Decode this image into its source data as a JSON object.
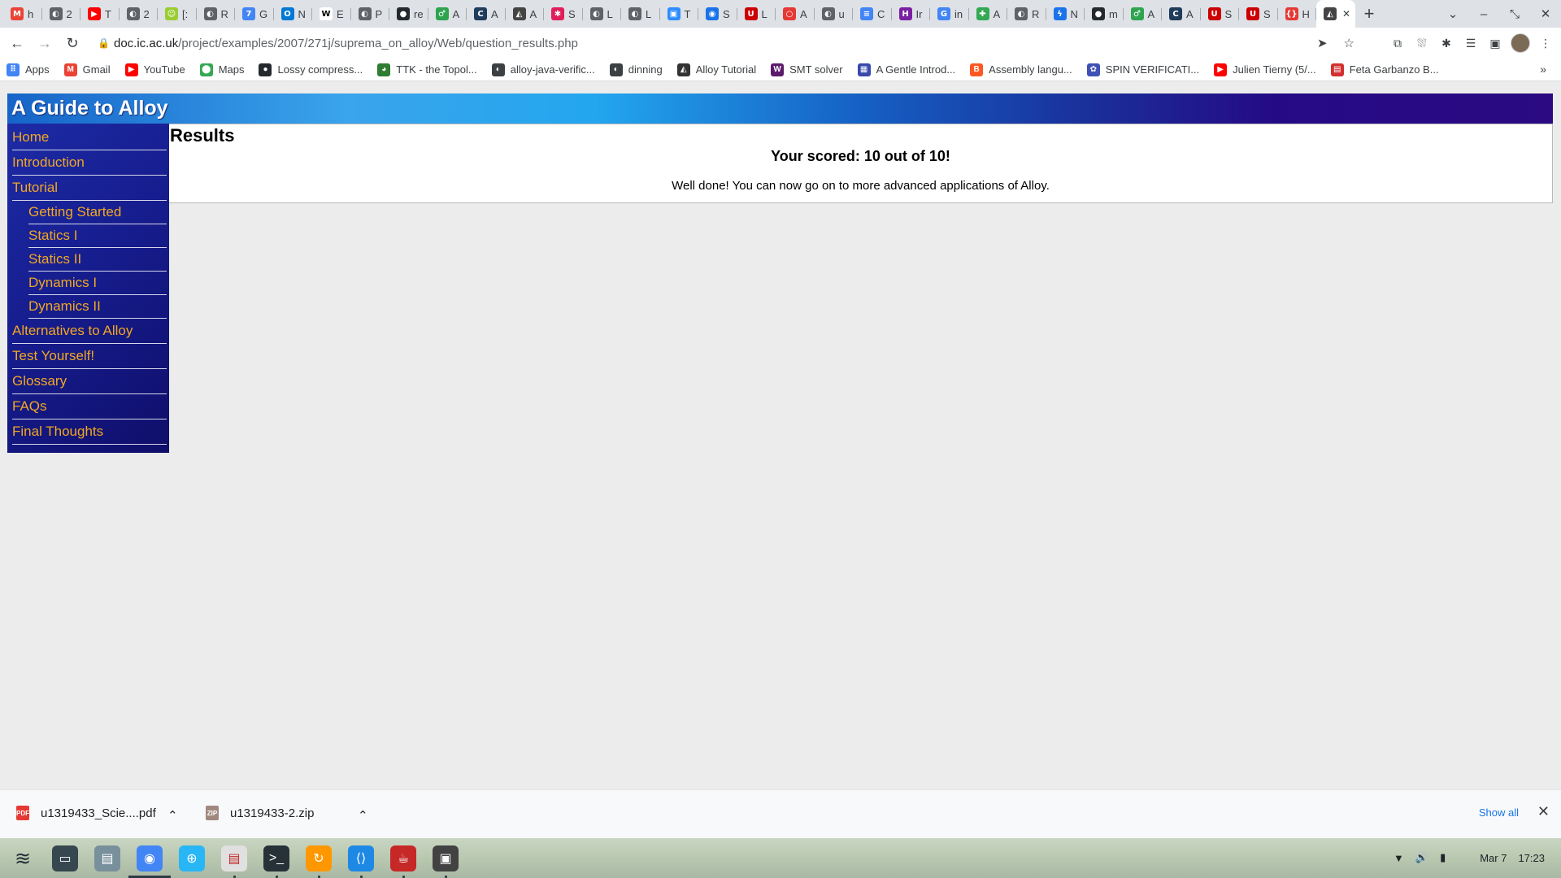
{
  "browser": {
    "tabs": [
      {
        "icon": "gmail-icon",
        "glyph": "M",
        "color": "#ea4335",
        "text": "h"
      },
      {
        "icon": "globe-icon",
        "glyph": "◐",
        "color": "#5f6368",
        "text": "2"
      },
      {
        "icon": "youtube-icon",
        "glyph": "▶",
        "color": "#ff0000",
        "text": "T"
      },
      {
        "icon": "globe-icon",
        "glyph": "◐",
        "color": "#5f6368",
        "text": "2"
      },
      {
        "icon": "smiley-icon",
        "glyph": "☺",
        "color": "#9acd32",
        "text": "[:"
      },
      {
        "icon": "globe-icon",
        "glyph": "◐",
        "color": "#5f6368",
        "text": "R"
      },
      {
        "icon": "calendar-icon",
        "glyph": "7",
        "color": "#4285f4",
        "text": "G"
      },
      {
        "icon": "outlook-icon",
        "glyph": "O",
        "color": "#0078d4",
        "text": "N"
      },
      {
        "icon": "wikipedia-icon",
        "glyph": "W",
        "color": "#ffffff",
        "text": "E"
      },
      {
        "icon": "globe-icon",
        "glyph": "◐",
        "color": "#5f6368",
        "text": "P"
      },
      {
        "icon": "github-icon",
        "glyph": "●",
        "color": "#24292e",
        "text": "re"
      },
      {
        "icon": "leaf-icon",
        "glyph": "♂",
        "color": "#2ea44f",
        "text": "A"
      },
      {
        "icon": "codecademy-icon",
        "glyph": "C",
        "color": "#1f3c5a",
        "text": "A"
      },
      {
        "icon": "alloy-icon",
        "glyph": "◭",
        "color": "#444444",
        "text": "A"
      },
      {
        "icon": "slack-icon",
        "glyph": "✱",
        "color": "#e01e5a",
        "text": "S"
      },
      {
        "icon": "globe-icon",
        "glyph": "◐",
        "color": "#5f6368",
        "text": "L"
      },
      {
        "icon": "globe-icon",
        "glyph": "◐",
        "color": "#5f6368",
        "text": "L"
      },
      {
        "icon": "zoom-icon",
        "glyph": "▣",
        "color": "#2d8cff",
        "text": "T"
      },
      {
        "icon": "globe-icon",
        "glyph": "◉",
        "color": "#1a73e8",
        "text": "S"
      },
      {
        "icon": "utah-icon",
        "glyph": "U",
        "color": "#cc0000",
        "text": "L"
      },
      {
        "icon": "circle-icon",
        "glyph": "○",
        "color": "#e53935",
        "text": "A"
      },
      {
        "icon": "globe-icon",
        "glyph": "◐",
        "color": "#5f6368",
        "text": "u"
      },
      {
        "icon": "docs-icon",
        "glyph": "≡",
        "color": "#4285f4",
        "text": "C"
      },
      {
        "icon": "hackmd-icon",
        "glyph": "H",
        "color": "#7b1fa2",
        "text": "Ir"
      },
      {
        "icon": "google-icon",
        "glyph": "G",
        "color": "#4285f4",
        "text": "in"
      },
      {
        "icon": "puzzle-icon",
        "glyph": "✚",
        "color": "#34a853",
        "text": "A"
      },
      {
        "icon": "globe-icon",
        "glyph": "◐",
        "color": "#5f6368",
        "text": "R"
      },
      {
        "icon": "flash-icon",
        "glyph": "ϟ",
        "color": "#1a73e8",
        "text": "N"
      },
      {
        "icon": "github-icon",
        "glyph": "●",
        "color": "#24292e",
        "text": "m"
      },
      {
        "icon": "leaf-icon",
        "glyph": "♂",
        "color": "#2ea44f",
        "text": "A"
      },
      {
        "icon": "codecademy-icon",
        "glyph": "C",
        "color": "#1f3c5a",
        "text": "A"
      },
      {
        "icon": "utah-icon",
        "glyph": "U",
        "color": "#cc0000",
        "text": "S"
      },
      {
        "icon": "utah-icon",
        "glyph": "U",
        "color": "#cc0000",
        "text": "S"
      },
      {
        "icon": "braces-icon",
        "glyph": "{}",
        "color": "#e53935",
        "text": "H"
      }
    ],
    "active_tab": {
      "icon": "alloy-icon",
      "glyph": "◭",
      "color": "#444444",
      "close": "✕"
    },
    "new_tab": "+",
    "window_controls": [
      "⌄",
      "–",
      "⤡",
      "✕"
    ],
    "nav": {
      "back": "←",
      "forward": "→",
      "reload": "↻"
    },
    "url": {
      "lock": "🔒",
      "host": "doc.ic.ac.uk",
      "path": "/project/examples/2007/271j/suprema_on_alloy/Web/question_results.php"
    },
    "url_actions": {
      "send": "➤",
      "star": "☆"
    },
    "toolbar_icons": [
      "⧉",
      "⛆",
      "✱",
      "☰",
      "▣"
    ],
    "menu": "⋮",
    "bookmarks": [
      {
        "label": "Apps",
        "icon": "apps-grid-icon",
        "glyph": "⠿",
        "color": "#4285f4"
      },
      {
        "label": "Gmail",
        "icon": "gmail-icon",
        "glyph": "M",
        "color": "#ea4335"
      },
      {
        "label": "YouTube",
        "icon": "youtube-icon",
        "glyph": "▶",
        "color": "#ff0000"
      },
      {
        "label": "Maps",
        "icon": "maps-pin-icon",
        "glyph": "⬤",
        "color": "#34a853"
      },
      {
        "label": "Lossy compress...",
        "icon": "github-icon",
        "glyph": "●",
        "color": "#24292e"
      },
      {
        "label": "TTK - the Topol...",
        "icon": "ttk-icon",
        "glyph": "◕",
        "color": "#2e7d32"
      },
      {
        "label": "alloy-java-verific...",
        "icon": "globe-icon",
        "glyph": "◐",
        "color": "#3c4043"
      },
      {
        "label": "dinning",
        "icon": "globe-icon",
        "glyph": "◐",
        "color": "#3c4043"
      },
      {
        "label": "Alloy Tutorial",
        "icon": "alloy-icon",
        "glyph": "◭",
        "color": "#333333"
      },
      {
        "label": "SMT solver",
        "icon": "w-icon",
        "glyph": "W",
        "color": "#5c1a6b"
      },
      {
        "label": "A Gentle Introd...",
        "icon": "grid-icon",
        "glyph": "▦",
        "color": "#3949ab"
      },
      {
        "label": "Assembly langu...",
        "icon": "blogger-icon",
        "glyph": "B",
        "color": "#ff5722"
      },
      {
        "label": "SPIN VERIFICATI...",
        "icon": "spin-icon",
        "glyph": "✿",
        "color": "#3f51b5"
      },
      {
        "label": "Julien Tierny (5/...",
        "icon": "youtube-icon",
        "glyph": "▶",
        "color": "#ff0000"
      },
      {
        "label": "Feta Garbanzo B...",
        "icon": "recipe-icon",
        "glyph": "▤",
        "color": "#d32f2f"
      }
    ],
    "bookmarks_more": "»"
  },
  "site": {
    "title": "A Guide to Alloy",
    "nav_main_top": [
      "Home",
      "Introduction",
      "Tutorial"
    ],
    "nav_sub": [
      "Getting Started",
      "Statics I",
      "Statics II",
      "Dynamics I",
      "Dynamics II"
    ],
    "nav_main_bottom": [
      "Alternatives to Alloy",
      "Test Yourself!",
      "Glossary",
      "FAQs",
      "Final Thoughts"
    ],
    "heading": "Results",
    "score": "Your scored: 10 out of 10!",
    "message": "Well done! You can now go on to more advanced applications of Alloy."
  },
  "downloads": {
    "items": [
      {
        "name": "u1319433_Scie....pdf",
        "icon": "pdf-icon",
        "badge": "PDF",
        "color": "#e53935"
      },
      {
        "name": "u1319433-2.zip",
        "icon": "zip-icon",
        "badge": "ZIP",
        "color": "#a1887f"
      }
    ],
    "chevron": "⌃",
    "show_all": "Show all",
    "close": "✕"
  },
  "taskbar": {
    "launcher_glyph": "≋",
    "apps": [
      {
        "name": "files-window",
        "glyph": "▭",
        "color": "#37474f"
      },
      {
        "name": "file-manager",
        "glyph": "▤",
        "color": "#78909c"
      },
      {
        "name": "chrome",
        "glyph": "◉",
        "color": "#4285f4"
      },
      {
        "name": "web-browser",
        "glyph": "⊕",
        "color": "#29b6f6"
      },
      {
        "name": "document-viewer",
        "glyph": "▤",
        "color": "#e0e0e0"
      },
      {
        "name": "terminal",
        "glyph": ">_",
        "color": "#263238"
      },
      {
        "name": "sync-app",
        "glyph": "↻",
        "color": "#ff9800"
      },
      {
        "name": "vscode",
        "glyph": "⟨⟩",
        "color": "#1e88e5"
      },
      {
        "name": "java-app",
        "glyph": "☕",
        "color": "#c62828"
      },
      {
        "name": "camera-app",
        "glyph": "▣",
        "color": "#424242"
      }
    ],
    "tray": {
      "wifi": "▼",
      "volume": "🔊",
      "battery": "▮",
      "date": "Mar 7",
      "time": "17:23"
    }
  }
}
